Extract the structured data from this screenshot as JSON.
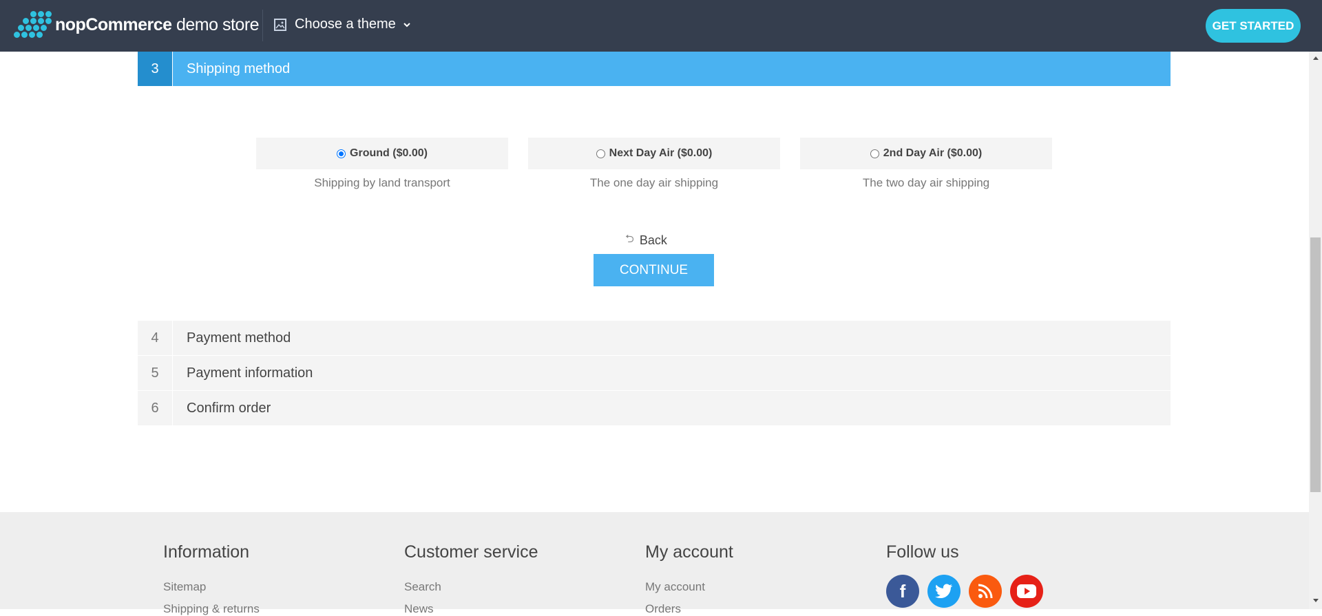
{
  "topbar": {
    "logo_brand": "nopCommerce",
    "logo_suffix": "demo store",
    "theme_label": "Choose a theme",
    "get_started": "GET STARTED"
  },
  "checkout": {
    "active_step": {
      "number": "3",
      "title": "Shipping method"
    },
    "shipping_options": [
      {
        "label": "Ground ($0.00)",
        "description": "Shipping by land transport",
        "selected": true
      },
      {
        "label": "Next Day Air ($0.00)",
        "description": "The one day air shipping",
        "selected": false
      },
      {
        "label": "2nd Day Air ($0.00)",
        "description": "The two day air shipping",
        "selected": false
      }
    ],
    "back_label": "Back",
    "continue_label": "CONTINUE",
    "steps": [
      {
        "number": "4",
        "title": "Payment method"
      },
      {
        "number": "5",
        "title": "Payment information"
      },
      {
        "number": "6",
        "title": "Confirm order"
      }
    ]
  },
  "footer": {
    "columns": [
      {
        "title": "Information",
        "first_link": "Sitemap",
        "second_link": "Shipping & returns"
      },
      {
        "title": "Customer service",
        "first_link": "Search",
        "second_link": "News"
      },
      {
        "title": "My account",
        "first_link": "My account",
        "second_link": "Orders"
      },
      {
        "title": "Follow us"
      }
    ],
    "social": [
      {
        "icon": "facebook-icon",
        "color": "#3b5998"
      },
      {
        "icon": "twitter-icon",
        "color": "#1da1f2"
      },
      {
        "icon": "rss-icon",
        "color": "#fa5a0f"
      },
      {
        "icon": "youtube-icon",
        "color": "#e62117"
      }
    ]
  },
  "colors": {
    "topbar_bg": "#353e4e",
    "accent": "#4ab2f1",
    "accent_dark": "#248ece",
    "brand_cyan": "#2fc2e0"
  }
}
